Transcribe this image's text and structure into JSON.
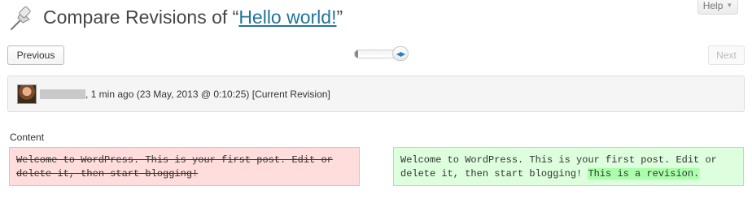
{
  "header": {
    "title_prefix": "Compare Revisions of “",
    "post_link": "Hello world!",
    "title_suffix": "”",
    "help_label": "Help"
  },
  "nav": {
    "previous_label": "Previous",
    "next_label": "Next",
    "slider_position": 1.0
  },
  "revision": {
    "author": "",
    "meta_text": ", 1 min ago (23 May, 2013 @ 0:10:25) [Current Revision]"
  },
  "content": {
    "label": "Content",
    "old_text": "Welcome to WordPress. This is your first post. Edit or delete it, then start blogging!",
    "new_text_prefix": "Welcome to WordPress. This is your first post. Edit or delete it, then start blogging! ",
    "new_text_added": "This is a revision."
  },
  "colors": {
    "link": "#21759b",
    "deleted_bg": "#ffdddd",
    "added_bg": "#ddffdd",
    "added_highlight": "#aaffaa"
  }
}
